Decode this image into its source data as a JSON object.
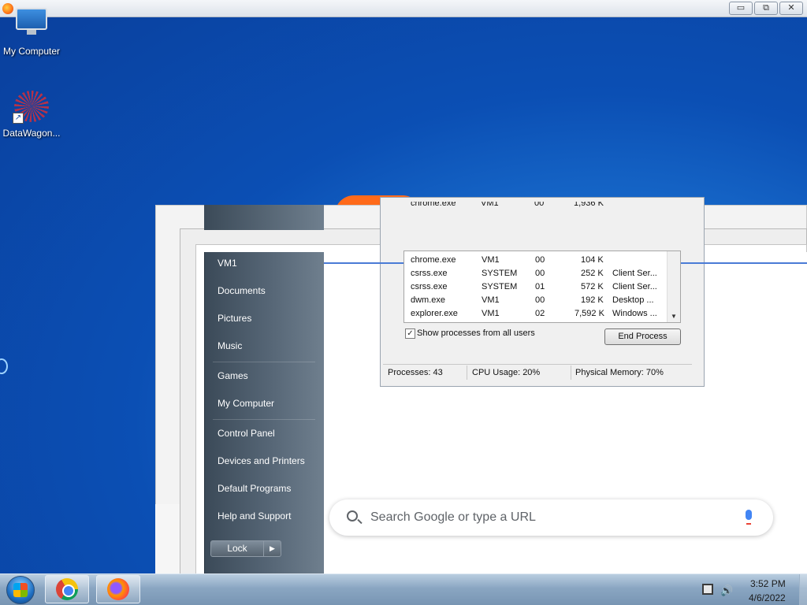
{
  "desktop": {
    "icons": [
      {
        "label": "My Computer",
        "icon": "computer-icon"
      },
      {
        "label": "DataWagon...",
        "icon": "datawagon-icon"
      }
    ]
  },
  "window_controls": {
    "minimize": "▭",
    "restore": "⧉",
    "close": "✕"
  },
  "task_manager": {
    "partial_row": {
      "name": "chrome.exe",
      "user": "VM1",
      "cpu": "00",
      "mem": "1,936 K"
    },
    "rows": [
      {
        "name": "chrome.exe",
        "user": "VM1",
        "cpu": "00",
        "mem": "104 K",
        "desc": ""
      },
      {
        "name": "csrss.exe",
        "user": "SYSTEM",
        "cpu": "00",
        "mem": "252 K",
        "desc": "Client Ser..."
      },
      {
        "name": "csrss.exe",
        "user": "SYSTEM",
        "cpu": "01",
        "mem": "572 K",
        "desc": "Client Ser..."
      },
      {
        "name": "dwm.exe",
        "user": "VM1",
        "cpu": "00",
        "mem": "192 K",
        "desc": "Desktop ..."
      },
      {
        "name": "explorer.exe",
        "user": "VM1",
        "cpu": "02",
        "mem": "7,592 K",
        "desc": "Windows ..."
      }
    ],
    "show_all_label": "Show processes from all users",
    "show_all_checked": "✓",
    "end_process_label": "End Process",
    "status": {
      "processes": "Processes: 43",
      "cpu": "CPU Usage: 20%",
      "memory": "Physical Memory: 70%"
    }
  },
  "start_menu": {
    "items": [
      {
        "label": "VM1"
      },
      {
        "label": "Documents"
      },
      {
        "label": "Pictures"
      },
      {
        "label": "Music"
      },
      {
        "label": "Games"
      },
      {
        "label": "My Computer"
      },
      {
        "label": "Control Panel"
      },
      {
        "label": "Devices and Printers"
      },
      {
        "label": "Default Programs"
      },
      {
        "label": "Help and Support"
      }
    ],
    "lock_label": "Lock",
    "lock_arrow": "▶"
  },
  "chrome": {
    "search_placeholder": "Search Google or type a URL"
  },
  "taskbar": {
    "apps": [
      "chrome-icon",
      "firefox-icon"
    ],
    "clock_time": "3:52 PM",
    "clock_date": "4/6/2022",
    "volume_glyph": "🔊"
  }
}
